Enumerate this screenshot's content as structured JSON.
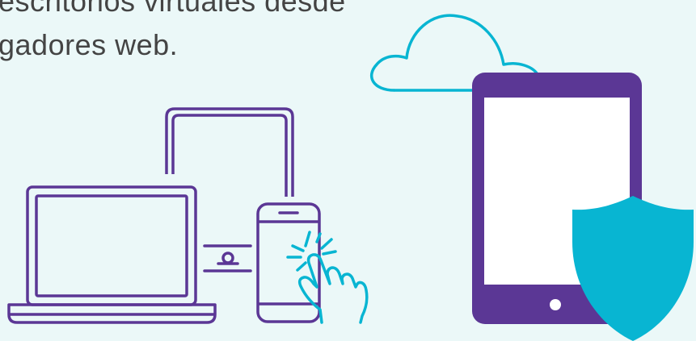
{
  "caption": {
    "line1": "escritorios virtuales desde",
    "line2": "gadores web."
  },
  "colors": {
    "background": "#ebf8f8",
    "text": "#444444",
    "purple": "#5b3795",
    "cyan": "#08b5d2",
    "screen": "#ffffff"
  },
  "icons": {
    "cloud": "cloud-icon",
    "laptop": "laptop-icon",
    "monitor": "monitor-icon",
    "smartphone": "smartphone-icon",
    "touch_hand": "pointing-hand-icon",
    "connector": "connector-icon",
    "tablet": "tablet-icon",
    "shield": "shield-icon"
  }
}
